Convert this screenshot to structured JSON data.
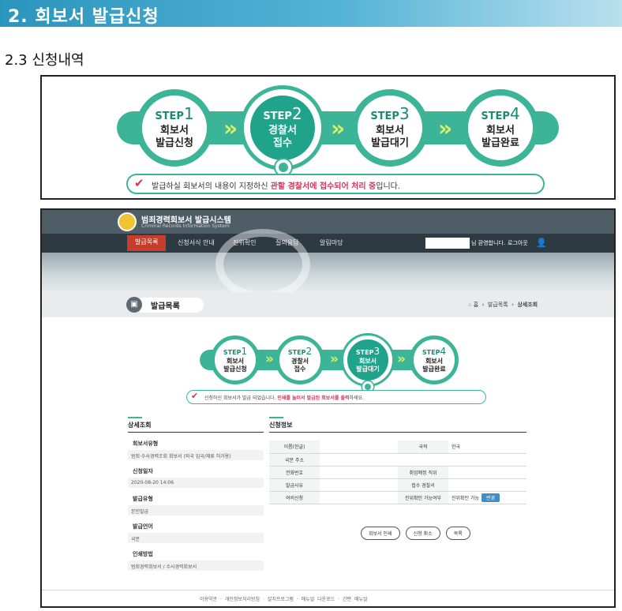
{
  "section": {
    "title": "2. 회보서 발급신청",
    "subtitle": "2.3 신청내역"
  },
  "stepper_main": {
    "steps": [
      {
        "label": "STEP",
        "num": "1",
        "line1": "회보서",
        "line2": "발급신청"
      },
      {
        "label": "STEP",
        "num": "2",
        "line1": "경찰서",
        "line2": "접수"
      },
      {
        "label": "STEP",
        "num": "3",
        "line1": "회보서",
        "line2": "발급대기"
      },
      {
        "label": "STEP",
        "num": "4",
        "line1": "회보서",
        "line2": "발급완료"
      }
    ],
    "active_step": 2,
    "chevron": "»",
    "notice_pre": "발급하실 회보서의 내용이 지정하신 ",
    "notice_red": "관할 경찰서에 접수되어 처리 중",
    "notice_post": "입니다."
  },
  "site": {
    "logo_title": "범죄경력회보서 발급시스템",
    "logo_sub": "Criminal Records Information System",
    "nav": [
      "발급목록",
      "신청서식 안내",
      "진위확인",
      "질의응답",
      "알림마당"
    ],
    "greeting": "님 환영합니다.",
    "logout": "로그아웃",
    "page_title": "발급목록",
    "crumbs": {
      "home": "홈",
      "level1": "발급목록",
      "level2": "상세조회",
      "sep": "›"
    }
  },
  "stepper_inner": {
    "steps": [
      {
        "label": "STEP",
        "num": "1",
        "line1": "회보서",
        "line2": "발급신청"
      },
      {
        "label": "STEP",
        "num": "2",
        "line1": "경찰서",
        "line2": "접수"
      },
      {
        "label": "STEP",
        "num": "3",
        "line1": "회보서",
        "line2": "발급대기"
      },
      {
        "label": "STEP",
        "num": "4",
        "line1": "회보서",
        "line2": "발급완료"
      }
    ],
    "active_step": 3,
    "notice_pre": "신청하신 회보서가 발급 되었습니다. ",
    "notice_red": "인쇄를 눌러서 발급된 회보서를 출력",
    "notice_post": "하세요."
  },
  "detail": {
    "heading": "상세조회",
    "fields": [
      {
        "label": "회보서유형",
        "value": "범죄·수사경력조회 회보서 (외국 입국/체류 허가용)"
      },
      {
        "label": "신청일자",
        "value": "2020-08-20 14:06"
      },
      {
        "label": "발급유형",
        "value": "본인발급"
      },
      {
        "label": "발급언어",
        "value": "국문"
      },
      {
        "label": "인쇄방법",
        "value": "범죄경력회보서 / 수사경력회보서"
      }
    ]
  },
  "info": {
    "heading": "신청정보",
    "rows": [
      {
        "k1": "이름(한글)",
        "v1": "",
        "k2": "국적",
        "v2": "한국"
      },
      {
        "k1": "국문 주소",
        "v1": "",
        "k2": "",
        "v2": ""
      },
      {
        "k1": "전화번호",
        "v1": "",
        "k2": "취업예정 직위",
        "v2": ""
      },
      {
        "k1": "발급사유",
        "v1": "",
        "k2": "접수 경찰서",
        "v2": ""
      },
      {
        "k1": "여의신청",
        "v1": "",
        "k2": "진위확인 가능여부",
        "v2": "진위확인 가능"
      }
    ],
    "edit_label": "변경",
    "buttons": [
      "회보서 인쇄",
      "신청 취소",
      "목록"
    ]
  },
  "footer": {
    "links": [
      "이용약관",
      "개인정보처리방침",
      "설치프로그램",
      "매뉴얼 다운로드",
      "간편 매뉴얼"
    ],
    "sep": "·"
  },
  "colors": {
    "accent_green": "#3cb497",
    "accent_red": "#d4365a",
    "header_blue": "#2a95bd",
    "nav_active": "#c63d2b"
  }
}
